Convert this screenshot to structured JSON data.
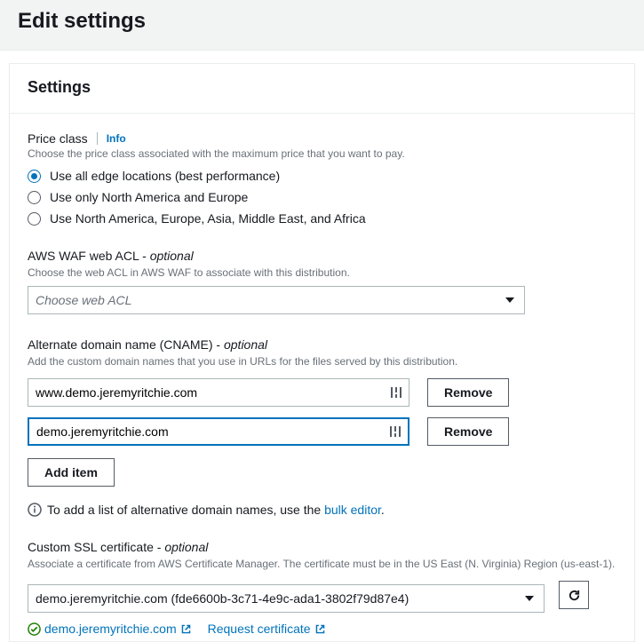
{
  "page": {
    "title": "Edit settings"
  },
  "settings": {
    "heading": "Settings",
    "priceClass": {
      "label": "Price class",
      "infoLabel": "Info",
      "hint": "Choose the price class associated with the maximum price that you want to pay.",
      "options": [
        {
          "label": "Use all edge locations (best performance)",
          "selected": true
        },
        {
          "label": "Use only North America and Europe",
          "selected": false
        },
        {
          "label": "Use North America, Europe, Asia, Middle East, and Africa",
          "selected": false
        }
      ]
    },
    "waf": {
      "label": "AWS WAF web ACL",
      "suffix": " - ",
      "optional": "optional",
      "hint": "Choose the web ACL in AWS WAF to associate with this distribution.",
      "placeholder": "Choose web ACL"
    },
    "cname": {
      "label": "Alternate domain name (CNAME)",
      "suffix": " - ",
      "optional": "optional",
      "hint": "Add the custom domain names that you use in URLs for the files served by this distribution.",
      "items": [
        {
          "value": "www.demo.jeremyritchie.com",
          "focused": false
        },
        {
          "value": "demo.jeremyritchie.com",
          "focused": true
        }
      ],
      "removeLabel": "Remove",
      "addItemLabel": "Add item",
      "notePrefix": "To add a list of alternative domain names, use the ",
      "noteLink": "bulk editor",
      "noteSuffix": "."
    },
    "ssl": {
      "label": "Custom SSL certificate",
      "suffix": " - ",
      "optional": "optional",
      "hint": "Associate a certificate from AWS Certificate Manager. The certificate must be in the US East (N. Virginia) Region (us-east-1).",
      "selected": "demo.jeremyritchie.com (fde6600b-3c71-4e9c-ada1-3802f79d87e4)",
      "certLink": "demo.jeremyritchie.com",
      "requestLink": "Request certificate"
    }
  }
}
